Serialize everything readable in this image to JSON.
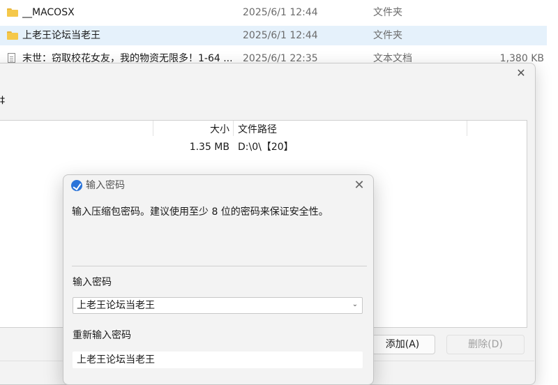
{
  "explorer": {
    "files": [
      {
        "name": "__MACOSX",
        "date": "2025/6/1 12:44",
        "type": "文件夹",
        "size": "",
        "icon": "folder-icon",
        "selected": false
      },
      {
        "name": "上老王论坛当老王",
        "date": "2025/6/1 12:44",
        "type": "文件夹",
        "size": "",
        "icon": "folder-icon",
        "selected": true
      },
      {
        "name": "末世：窃取校花女友，我的物资无限多！1-64 ...",
        "date": "2025/6/1 22:35",
        "type": "文本文档",
        "size": "1,380 KB",
        "icon": "text-file-icon",
        "selected": false
      }
    ]
  },
  "archive_dialog": {
    "close_glyph": "✕",
    "title_fragment": "‡",
    "table": {
      "headers": {
        "size": "大小",
        "path": "文件路径"
      },
      "rows": [
        {
          "size": "1.35 MB",
          "path": "D:\\0\\【20】"
        }
      ]
    },
    "buttons": {
      "add": "添加(A)",
      "delete": "删除(D)"
    }
  },
  "password_dialog": {
    "title": "输入密码",
    "close_glyph": "✕",
    "description": "输入压缩包密码。建议使用至少 8 位的密码来保证安全性。",
    "password_label": "输入密码",
    "password_value": "上老王论坛当老王",
    "confirm_label": "重新输入密码",
    "confirm_value": "上老王论坛当老王",
    "dropdown_glyph": "⌄"
  }
}
